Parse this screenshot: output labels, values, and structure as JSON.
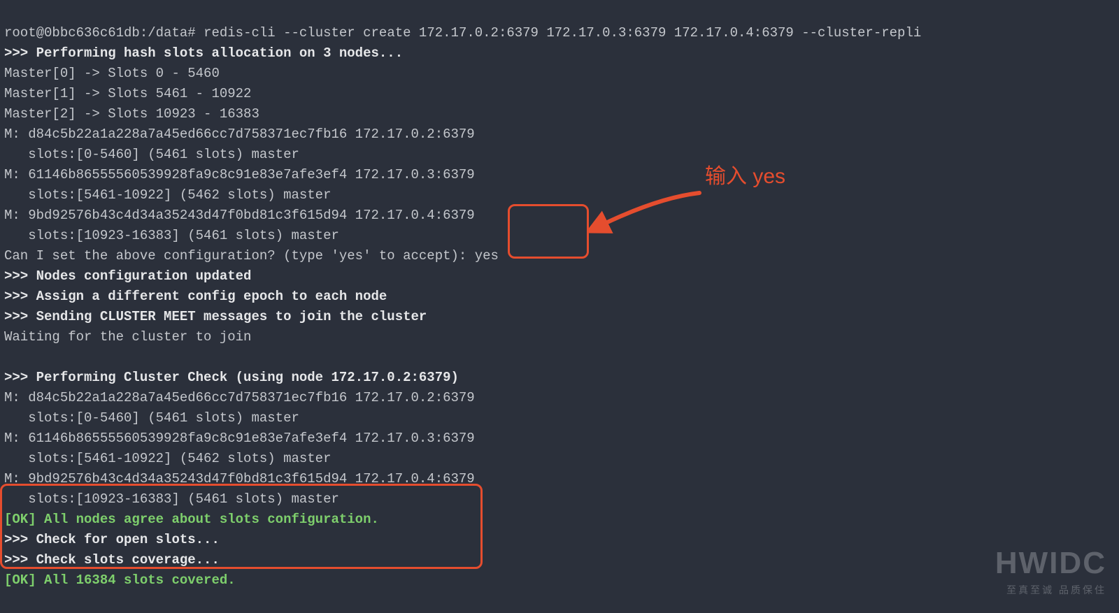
{
  "prompt": {
    "user_host": "root@0bbc636c61db",
    "cwd": "/data",
    "command": "redis-cli --cluster create 172.17.0.2:6379 172.17.0.3:6379 172.17.0.4:6379 --cluster-repli"
  },
  "lines": {
    "alloc_header": ">>> Performing hash slots allocation on 3 nodes...",
    "master0": "Master[0] -> Slots 0 - 5460",
    "master1": "Master[1] -> Slots 5461 - 10922",
    "master2": "Master[2] -> Slots 10923 - 16383",
    "m1a": "M: d84c5b22a1a228a7a45ed66cc7d758371ec7fb16 172.17.0.2:6379",
    "m1b": "   slots:[0-5460] (5461 slots) master",
    "m2a": "M: 61146b86555560539928fa9c8c91e83e7afe3ef4 172.17.0.3:6379",
    "m2b": "   slots:[5461-10922] (5462 slots) master",
    "m3a": "M: 9bd92576b43c4d34a35243d47f0bd81c3f615d94 172.17.0.4:6379",
    "m3b": "   slots:[10923-16383] (5461 slots) master",
    "confirm_prompt": "Can I set the above configuration? (type 'yes' to accept): ",
    "confirm_input": "yes",
    "nodes_updated": ">>> Nodes configuration updated",
    "assign_epoch": ">>> Assign a different config epoch to each node",
    "send_meet": ">>> Sending CLUSTER MEET messages to join the cluster",
    "waiting": "Waiting for the cluster to join",
    "blank": "",
    "check_header": ">>> Performing Cluster Check (using node 172.17.0.2:6379)",
    "c1a": "M: d84c5b22a1a228a7a45ed66cc7d758371ec7fb16 172.17.0.2:6379",
    "c1b": "   slots:[0-5460] (5461 slots) master",
    "c2a": "M: 61146b86555560539928fa9c8c91e83e7afe3ef4 172.17.0.3:6379",
    "c2b": "   slots:[5461-10922] (5462 slots) master",
    "c3a": "M: 9bd92576b43c4d34a35243d47f0bd81c3f615d94 172.17.0.4:6379",
    "c3b": "   slots:[10923-16383] (5461 slots) master",
    "ok_agree": "[OK] All nodes agree about slots configuration.",
    "check_open": ">>> Check for open slots...",
    "check_cov": ">>> Check slots coverage...",
    "ok_covered": "[OK] All 16384 slots covered."
  },
  "annotation": {
    "text": "输入 yes"
  },
  "watermark": {
    "brand": "HWIDC",
    "tagline": "至真至诚 品质保住"
  },
  "colors": {
    "bg": "#2b303b",
    "fg": "#c4c7cc",
    "bold": "#e6e7e9",
    "green": "#7ecf6c",
    "accent": "#e54d2e"
  }
}
